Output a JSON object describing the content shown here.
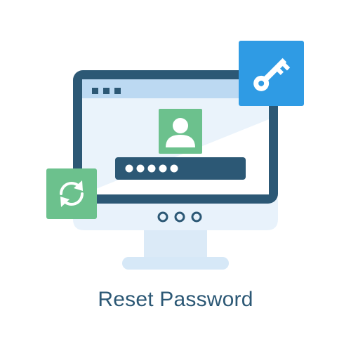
{
  "caption": "Reset Password",
  "password": {
    "mask_dots": 5
  },
  "icons": {
    "user": "user-icon",
    "key": "key-icon",
    "refresh": "refresh-icon"
  },
  "colors": {
    "monitor_frame": "#2c5875",
    "screen_bg": "#eaf3fb",
    "title_bar": "#bcd9f2",
    "green": "#6cc18d",
    "blue": "#2f9be4",
    "stand": "#d6e8f7"
  }
}
